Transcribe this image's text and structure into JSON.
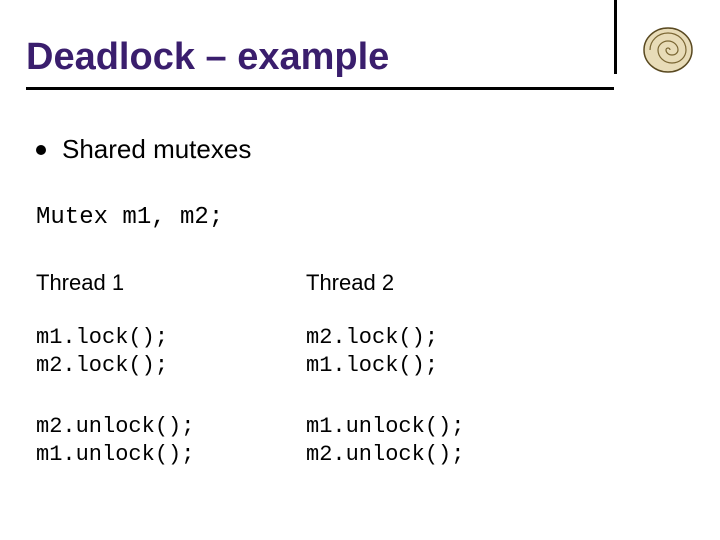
{
  "title": "Deadlock – example",
  "bullet": "Shared mutexes",
  "declaration": "Mutex m1, m2;",
  "columns": [
    {
      "heading": "Thread 1",
      "lock_lines": "m1.lock();\nm2.lock();",
      "unlock_lines": "m2.unlock();\nm1.unlock();"
    },
    {
      "heading": "Thread 2",
      "lock_lines": "m2.lock();\nm1.lock();",
      "unlock_lines": "m1.unlock();\nm2.unlock();"
    }
  ],
  "logo": {
    "alt": "spiral-shell-icon"
  }
}
